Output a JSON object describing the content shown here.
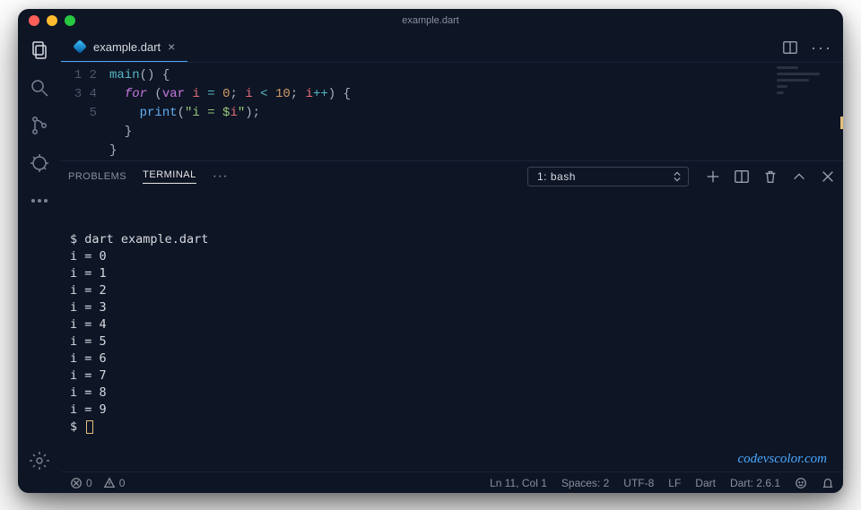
{
  "window": {
    "title": "example.dart"
  },
  "tab": {
    "filename": "example.dart"
  },
  "editor": {
    "lines": [
      "1",
      "2",
      "3",
      "4",
      "5"
    ],
    "code_tokens": [
      [
        [
          "fn",
          "main"
        ],
        [
          "punc",
          "() {"
        ]
      ],
      [
        [
          "punc",
          "  "
        ],
        [
          "kw2",
          "for"
        ],
        [
          "punc",
          " ("
        ],
        [
          "kw",
          "var"
        ],
        [
          "punc",
          " "
        ],
        [
          "ident",
          "i"
        ],
        [
          "punc",
          " "
        ],
        [
          "op",
          "="
        ],
        [
          "punc",
          " "
        ],
        [
          "num",
          "0"
        ],
        [
          "punc",
          "; "
        ],
        [
          "ident",
          "i"
        ],
        [
          "punc",
          " "
        ],
        [
          "op",
          "<"
        ],
        [
          "punc",
          " "
        ],
        [
          "num",
          "10"
        ],
        [
          "punc",
          "; "
        ],
        [
          "ident",
          "i"
        ],
        [
          "op",
          "++"
        ],
        [
          "punc",
          ") {"
        ]
      ],
      [
        [
          "punc",
          "    "
        ],
        [
          "fn2",
          "print"
        ],
        [
          "punc",
          "("
        ],
        [
          "str",
          "\"i = $"
        ],
        [
          "ident",
          "i"
        ],
        [
          "str",
          "\""
        ],
        [
          "punc",
          ");"
        ]
      ],
      [
        [
          "punc",
          "  }"
        ]
      ],
      [
        [
          "punc",
          "}"
        ]
      ]
    ]
  },
  "panel": {
    "tabs": {
      "problems": "PROBLEMS",
      "terminal": "TERMINAL"
    },
    "shell_selector": "1: bash"
  },
  "terminal": {
    "prompt": "$",
    "command": "dart example.dart",
    "output": [
      "i = 0",
      "i = 1",
      "i = 2",
      "i = 3",
      "i = 4",
      "i = 5",
      "i = 6",
      "i = 7",
      "i = 8",
      "i = 9"
    ]
  },
  "statusbar": {
    "errors": "0",
    "warnings": "0",
    "position": "Ln 11, Col 1",
    "spaces": "Spaces: 2",
    "encoding": "UTF-8",
    "eol": "LF",
    "language": "Dart",
    "sdk": "Dart: 2.6.1"
  },
  "watermark": "codevscolor.com"
}
